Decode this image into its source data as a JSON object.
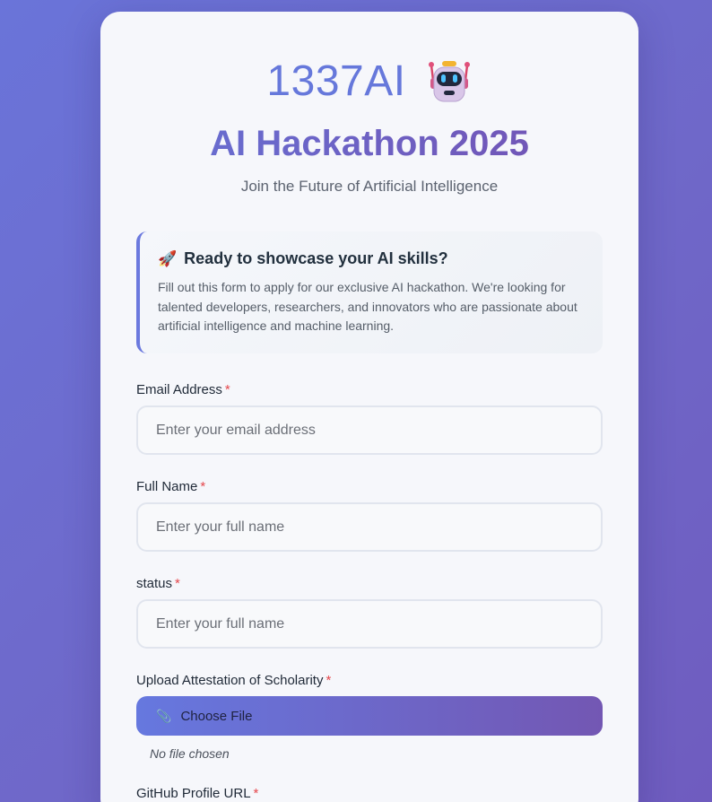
{
  "header": {
    "logo_text": "1337AI",
    "title": "AI Hackathon 2025",
    "subtitle": "Join the Future of Artificial Intelligence"
  },
  "info": {
    "icon": "rocket-icon",
    "heading": "Ready to showcase your AI skills?",
    "body": "Fill out this form to apply for our exclusive AI hackathon. We're looking for talented developers, researchers, and innovators who are passionate about artificial intelligence and machine learning."
  },
  "form": {
    "required_marker": "*",
    "email": {
      "label": "Email Address",
      "placeholder": "Enter your email address",
      "value": ""
    },
    "full_name": {
      "label": "Full Name",
      "placeholder": "Enter your full name",
      "value": ""
    },
    "status": {
      "label": "status",
      "placeholder": "Enter your full name",
      "value": ""
    },
    "attestation": {
      "label": "Upload Attestation of Scholarity",
      "button_label": "Choose File",
      "file_status": "No file chosen"
    },
    "github": {
      "label": "GitHub Profile URL"
    }
  },
  "colors": {
    "accent": "#6678db",
    "required": "#e5484d",
    "background_start": "#6a74d9",
    "background_end": "#6f5cbf"
  }
}
